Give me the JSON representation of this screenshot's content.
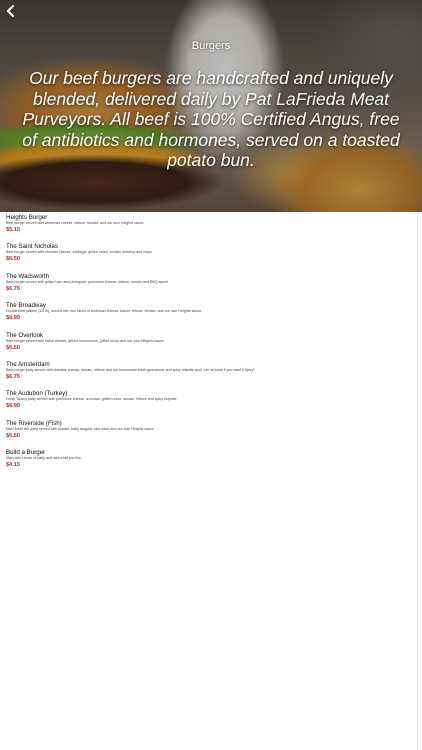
{
  "header": {
    "title": "Burgers",
    "description": "Our beef burgers are handcrafted and uniquely blended, delivered daily by Pat LaFrieda Meat Purveyors. All beef is 100% Certified Angus, free of antibiotics and hormones, served on a toasted potato bun.",
    "back_icon": "chevron-left-icon"
  },
  "colors": {
    "price": "#c1272d",
    "text": "#111111"
  },
  "items": [
    {
      "name": "Heights Burger",
      "description": "Beef burger served with American cheese, lettuce, tomato, and our own Heights sauce.",
      "price": "$5.15"
    },
    {
      "name": "The Saint Nicholas",
      "description": "Beef burger served with cheddar cheese, cabbage, grilled onion, tomato, ketchup and mayo.",
      "price": "$6.50"
    },
    {
      "name": "The Wadsworth",
      "description": "Beef burger served with grilled ham and pineapple, provolone cheese, lettuce, tomato and BBQ sauce.",
      "price": "$6.75"
    },
    {
      "name": "The Broadway",
      "description": "Double beef patties (1/2 lb), served with two slices of american cheese, bacon, lettuce, tomato, and our own Heights sauce.",
      "price": "$8.99"
    },
    {
      "name": "The Overlook",
      "description": "Beef burger served with swiss cheese, grilled mushrooms, grilled onion and our own Heights sauce.",
      "price": "$6.50"
    },
    {
      "name": "The Amsterdam",
      "description": "Beef burger patty served with cheddar cheese, tomato, lettuce and our homemade fresh guacamole and spicy chipotle aioli. Let us know if you want it Spicy!",
      "price": "$6.75"
    },
    {
      "name": "The Audubon (Turkey)",
      "description": "Fresh Turkey patty served with provolone cheese, avocado, grilled onion, tomato, lettuce and spicy chipotle.",
      "price": "$6.99"
    },
    {
      "name": "The Riverside (Fish)",
      "description": "Mahi Mahi fish patty served with tomato, baby arugula, raw onion and our own Heights sauce.",
      "price": "$6.50"
    },
    {
      "name": "Build a Burger",
      "description": "Start with choice of patty and add what you like.",
      "price": "$4.15"
    }
  ]
}
